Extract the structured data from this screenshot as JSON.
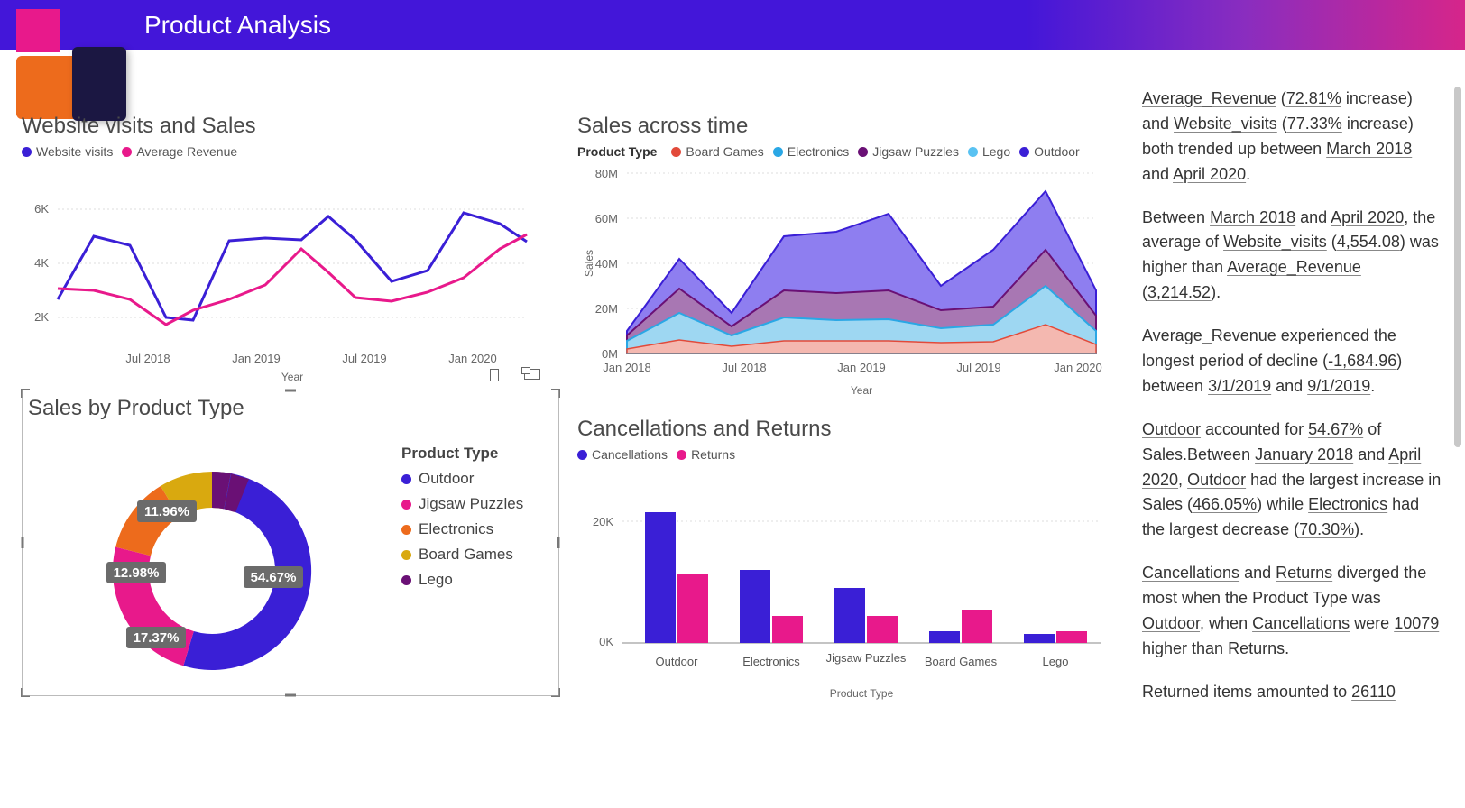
{
  "header": {
    "title": "Product Analysis"
  },
  "colors": {
    "blue": "#3a1fd6",
    "pink": "#e8198b",
    "orange": "#ed6b1c",
    "gold": "#d9a90f",
    "purple": "#6a1075",
    "lightblue": "#2aa7e5",
    "red": "#e24a3a"
  },
  "chart1": {
    "title": "Website visits and Sales",
    "legend": [
      "Website visits",
      "Average Revenue"
    ],
    "xlabel": "Year",
    "yticks": [
      "2K",
      "4K",
      "6K"
    ],
    "xticks": [
      "Jul 2018",
      "Jan 2019",
      "Jul 2019",
      "Jan 2020"
    ]
  },
  "chart2": {
    "title": "Sales across time",
    "legend_title": "Product Type",
    "legend": [
      "Board Games",
      "Electronics",
      "Jigsaw Puzzles",
      "Lego",
      "Outdoor"
    ],
    "xlabel": "Year",
    "ylabel": "Sales",
    "yticks": [
      "0M",
      "20M",
      "40M",
      "60M",
      "80M"
    ],
    "xticks": [
      "Jan 2018",
      "Jul 2018",
      "Jan 2019",
      "Jul 2019",
      "Jan 2020"
    ]
  },
  "chart3": {
    "title": "Sales by Product Type",
    "legend_title": "Product Type",
    "legend": [
      "Outdoor",
      "Jigsaw Puzzles",
      "Electronics",
      "Board Games",
      "Lego"
    ],
    "labels": {
      "outdoor": "54.67%",
      "jigsaw": "17.37%",
      "electronics": "12.98%",
      "board": "11.96%"
    }
  },
  "chart4": {
    "title": "Cancellations and Returns",
    "legend": [
      "Cancellations",
      "Returns"
    ],
    "xlabel": "Product Type",
    "yticks": [
      "0K",
      "20K"
    ],
    "categories": [
      "Outdoor",
      "Electronics",
      "Jigsaw Puzzles",
      "Board Games",
      "Lego"
    ]
  },
  "narrative": {
    "p1_a": "Average_Revenue",
    "p1_b": " (",
    "p1_c": "72.81%",
    "p1_d": " increase) and ",
    "p1_e": "Website_visits",
    "p1_f": " (",
    "p1_g": "77.33%",
    "p1_h": " increase) both trended up between ",
    "p1_i": "March 2018",
    "p1_j": " and ",
    "p1_k": "April 2020",
    "p1_l": ".",
    "p2_a": "Between ",
    "p2_b": "March 2018",
    "p2_c": " and ",
    "p2_d": "April 2020",
    "p2_e": ", the average of ",
    "p2_f": "Website_visits",
    "p2_g": " (",
    "p2_h": "4,554.08",
    "p2_i": ") was higher than ",
    "p2_j": "Average_Revenue",
    "p2_k": " (",
    "p2_l": "3,214.52",
    "p2_m": ").",
    "p3_a": "Average_Revenue",
    "p3_b": " experienced the longest period of decline (",
    "p3_c": "-1,684.96",
    "p3_d": ") between ",
    "p3_e": "3/1/2019",
    "p3_f": " and ",
    "p3_g": "9/1/2019",
    "p3_h": ".",
    "p4_a": "Outdoor",
    "p4_b": " accounted for ",
    "p4_c": "54.67%",
    "p4_d": " of Sales.",
    "p4_e": "Between ",
    "p4_f": "January 2018",
    "p4_g": " and ",
    "p4_h": "April 2020",
    "p4_i": ", ",
    "p4_j": "Outdoor",
    "p4_k": " had the largest increase in Sales (",
    "p4_l": "466.05%",
    "p4_m": ") while ",
    "p4_n": "Electronics",
    "p4_o": " had the largest decrease (",
    "p4_p": "70.30%",
    "p4_q": ").",
    "p5_a": "Cancellations",
    "p5_b": " and ",
    "p5_c": "Returns",
    "p5_d": " diverged the most when the Product Type was ",
    "p5_e": "Outdoor",
    "p5_f": ", when ",
    "p5_g": "Cancellations",
    "p5_h": " were ",
    "p5_i": "10079",
    "p5_j": " higher than ",
    "p5_k": "Returns",
    "p5_l": ".",
    "p6_a": "Returned items amounted to ",
    "p6_b": "26110"
  },
  "chart_data": [
    {
      "type": "line",
      "title": "Website visits and Sales",
      "xlabel": "Year",
      "ylabel": "",
      "x": [
        "2018-03",
        "2018-05",
        "2018-07",
        "2018-09",
        "2018-11",
        "2019-01",
        "2019-03",
        "2019-05",
        "2019-07",
        "2019-09",
        "2019-11",
        "2020-01",
        "2020-03",
        "2020-04"
      ],
      "series": [
        {
          "name": "Website visits",
          "values": [
            2800,
            5000,
            4700,
            2400,
            2300,
            5200,
            5400,
            5300,
            6100,
            5300,
            3600,
            4000,
            6200,
            5800,
            5000
          ]
        },
        {
          "name": "Average Revenue",
          "values": [
            3200,
            3100,
            2800,
            2000,
            2500,
            2800,
            3300,
            4700,
            3800,
            2800,
            2700,
            3000,
            3500,
            4700,
            5400
          ]
        }
      ],
      "ylim": [
        0,
        6500
      ]
    },
    {
      "type": "area",
      "title": "Sales across time",
      "xlabel": "Year",
      "ylabel": "Sales",
      "x": [
        "2018-01",
        "2018-04",
        "2018-07",
        "2018-10",
        "2019-01",
        "2019-04",
        "2019-07",
        "2019-10",
        "2020-01",
        "2020-04"
      ],
      "series": [
        {
          "name": "Board Games",
          "values": [
            2,
            5,
            3,
            4,
            5,
            5,
            5,
            5,
            8,
            3
          ]
        },
        {
          "name": "Electronics",
          "values": [
            4,
            12,
            7,
            12,
            14,
            12,
            8,
            9,
            18,
            6
          ]
        },
        {
          "name": "Jigsaw Puzzles",
          "values": [
            3,
            10,
            5,
            13,
            10,
            12,
            7,
            8,
            14,
            8
          ]
        },
        {
          "name": "Lego",
          "values": [
            1,
            2,
            1,
            2,
            2,
            2,
            2,
            2,
            6,
            2
          ]
        },
        {
          "name": "Outdoor",
          "values": [
            2,
            12,
            3,
            22,
            23,
            32,
            10,
            20,
            28,
            10
          ]
        }
      ],
      "ylim": [
        0,
        80
      ],
      "unit": "M"
    },
    {
      "type": "pie",
      "title": "Sales by Product Type",
      "series": [
        {
          "name": "Outdoor",
          "value": 54.67
        },
        {
          "name": "Jigsaw Puzzles",
          "value": 17.37
        },
        {
          "name": "Electronics",
          "value": 12.98
        },
        {
          "name": "Board Games",
          "value": 11.96
        },
        {
          "name": "Lego",
          "value": 3.02
        }
      ]
    },
    {
      "type": "bar",
      "title": "Cancellations and Returns",
      "xlabel": "Product Type",
      "ylabel": "",
      "categories": [
        "Outdoor",
        "Electronics",
        "Jigsaw Puzzles",
        "Board Games",
        "Lego"
      ],
      "series": [
        {
          "name": "Cancellations",
          "values": [
            21500,
            12000,
            9000,
            2000,
            1500
          ]
        },
        {
          "name": "Returns",
          "values": [
            11500,
            4500,
            4500,
            5500,
            2000
          ]
        }
      ],
      "ylim": [
        0,
        22000
      ]
    }
  ]
}
